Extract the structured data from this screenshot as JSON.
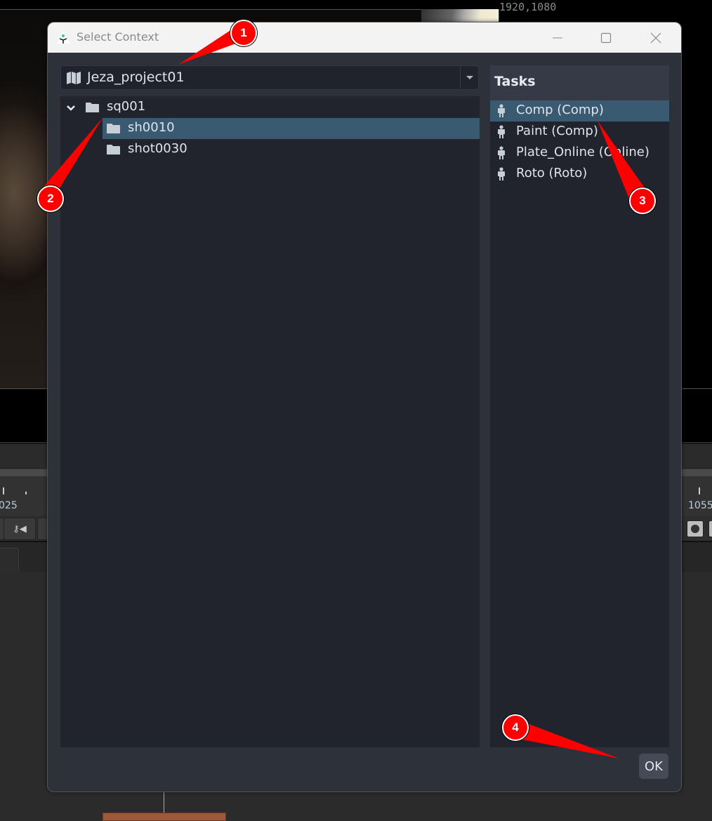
{
  "background_app": {
    "resolution_label": "1920,1080",
    "timeline_left_frame": "025",
    "timeline_right_frame": "1055"
  },
  "dialog": {
    "title": "Select Context",
    "window_controls": {
      "minimize_icon": "minimize-icon",
      "maximize_icon": "maximize-icon",
      "close_icon": "close-icon"
    },
    "project_selector": {
      "icon": "map-icon",
      "value": "Jeza_project01"
    },
    "tree": [
      {
        "label": "sq001",
        "icon": "folder-icon",
        "expanded": true,
        "level": 0,
        "selected": false
      },
      {
        "label": "sh0010",
        "icon": "folder-icon",
        "level": 1,
        "selected": true
      },
      {
        "label": "shot0030",
        "icon": "folder-icon",
        "level": 1,
        "selected": false
      }
    ],
    "tasks": {
      "header": "Tasks",
      "items": [
        {
          "label": "Comp (Comp)",
          "icon": "person-icon",
          "selected": true
        },
        {
          "label": "Paint (Comp)",
          "icon": "person-icon",
          "selected": false
        },
        {
          "label": "Plate_Online (Online)",
          "icon": "person-icon",
          "selected": false
        },
        {
          "label": "Roto (Roto)",
          "icon": "person-icon",
          "selected": false
        }
      ]
    },
    "ok_label": "OK"
  },
  "annotations": {
    "color": "#ff0000",
    "badges": [
      "1",
      "2",
      "3",
      "4"
    ]
  }
}
